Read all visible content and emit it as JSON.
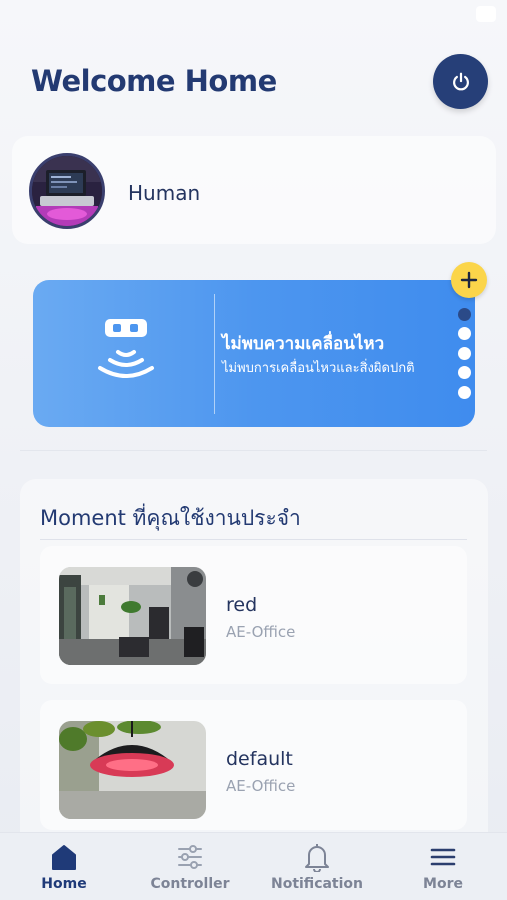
{
  "header": {
    "title": "Welcome Home",
    "power_icon": "power-icon"
  },
  "profile": {
    "name": "Human",
    "avatar": "avatar-laptop-photo"
  },
  "motion_card": {
    "icon": "motion-sensor-icon",
    "title": "ไม่พบความเคลื่อนไหว",
    "subtitle": "ไม่พบการเคลื่อนไหวและสิ่งผิดปกติ",
    "page_count": 5,
    "active_page": 1,
    "add_icon": "plus-icon"
  },
  "moments": {
    "title": "Moment ที่คุณใช้งานประจำ",
    "items": [
      {
        "name": "red",
        "location": "AE-Office",
        "thumbnail": "office-photo"
      },
      {
        "name": "default",
        "location": "AE-Office",
        "thumbnail": "red-lamp-photo"
      }
    ]
  },
  "bottom_nav": {
    "items": [
      {
        "label": "Home",
        "icon": "home-icon",
        "active": true
      },
      {
        "label": "Controller",
        "icon": "sliders-icon",
        "active": false
      },
      {
        "label": "Notification",
        "icon": "bell-icon",
        "active": false
      },
      {
        "label": "More",
        "icon": "menu-icon",
        "active": false
      }
    ]
  },
  "colors": {
    "primary": "#233a72",
    "card_blue": "#4d96ef",
    "accent_yellow": "#fbd54a",
    "muted_text": "#9aa2b1"
  }
}
